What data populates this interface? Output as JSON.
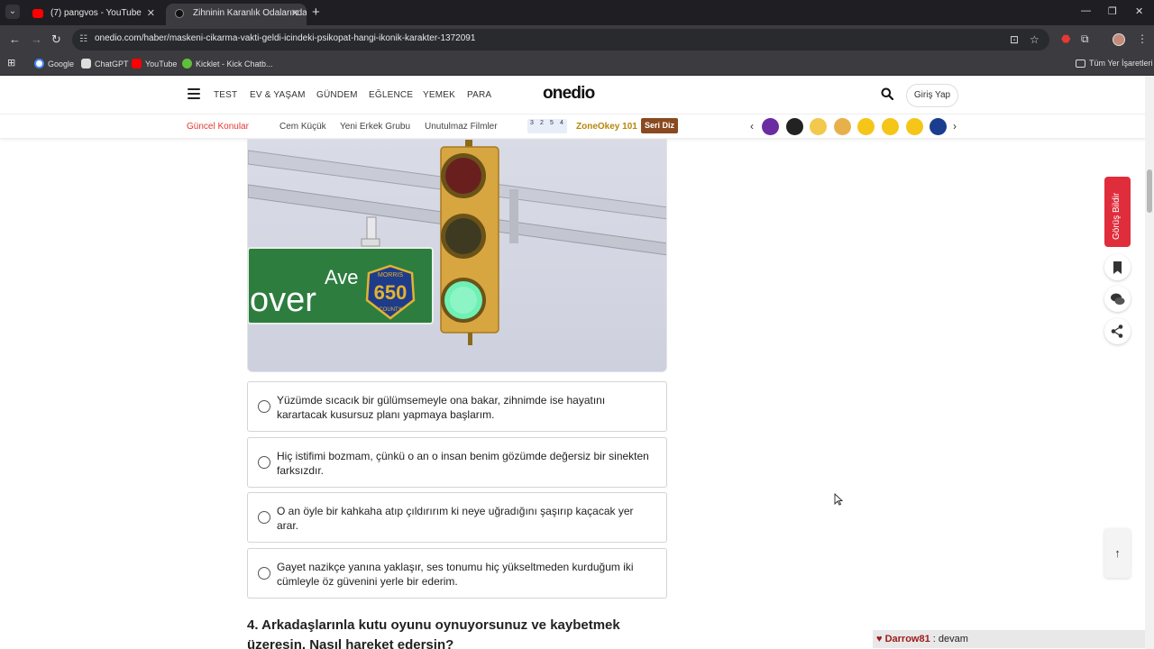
{
  "browser": {
    "tabs": [
      {
        "title": "(7) pangvos - YouTube",
        "active": false
      },
      {
        "title": "Zihninin Karanlık Odalarında Ka",
        "active": true
      }
    ],
    "url": "onedio.com/haber/maskeni-cikarma-vakti-geldi-icindeki-psikopat-hangi-ikonik-karakter-1372091",
    "bookmarks": [
      "Google",
      "ChatGPT",
      "YouTube",
      "Kicklet - Kick Chatb..."
    ],
    "all_bookmarks": "Tüm Yer İşaretleri"
  },
  "site": {
    "logo": "onedio",
    "nav": [
      "TEST",
      "EV & YAŞAM",
      "GÜNDEM",
      "EĞLENCE",
      "YEMEK",
      "PARA"
    ],
    "login": "Giriş Yap",
    "subnav": {
      "hot": "Güncel Konular",
      "links": [
        "Cem Küçük",
        "Yeni Erkek Grubu",
        "Unutulmaz Filmler"
      ],
      "zone_digits": [
        "3",
        "2",
        "5",
        "4"
      ],
      "zone_label": "ZoneOkey 101",
      "badge": "Seri Diz"
    },
    "emoji_colors": [
      "#6a2ca0",
      "#222222",
      "#f2c94c",
      "#e8b04a",
      "#f5c518",
      "#f5c518",
      "#f5c518",
      "#1a3d8f"
    ]
  },
  "hero_sign": {
    "street": "over",
    "suffix": "Ave",
    "shield_top": "MORRIS",
    "shield_number": "650",
    "shield_bottom": "COUNTY"
  },
  "options": [
    "Yüzümde sıcacık bir gülümsemeyle ona bakar, zihnimde ise hayatını karartacak kusursuz planı yapmaya başlarım.",
    "Hiç istifimi bozmam, çünkü o an o insan benim gözümde değersiz bir sinekten farksızdır.",
    "O an öyle bir kahkaha atıp çıldırırım ki neye uğradığını şaşırıp kaçacak yer arar.",
    "Gayet nazikçe yanına yaklaşır, ses tonumu hiç yükseltmeden kurduğum iki cümleyle öz güvenini yerle bir ederim."
  ],
  "next_question": "4. Arkadaşlarınla kutu oyunu oynuyorsunuz ve kaybetmek üzeresin. Nasıl hareket edersin?",
  "side": {
    "report": "Görüş Bildir",
    "to_top": "↑"
  },
  "chat_overlay": {
    "user": "Darrow81",
    "separator": " : ",
    "message": "devam"
  },
  "colors": {
    "accent_red": "#e02d3c",
    "zone_gold": "#b8860b",
    "badge_brown": "#8a4a20"
  }
}
